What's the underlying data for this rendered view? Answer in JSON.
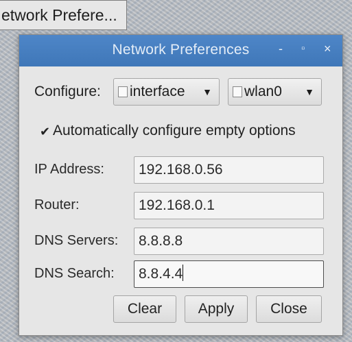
{
  "taskbar": {
    "label": "etwork Prefere..."
  },
  "dialog": {
    "title": "Network Preferences",
    "controls": {
      "minimize": "-",
      "maximize": "▫",
      "close": "×"
    },
    "configure": {
      "label": "Configure:",
      "type_value": "interface",
      "type_icon": "interface-icon",
      "device_value": "wlan0",
      "device_icon": "file-icon"
    },
    "auto_config": {
      "checked": true,
      "label": "Automatically configure empty options"
    },
    "fields": {
      "ip": {
        "label": "IP Address:",
        "value": "192.168.0.56"
      },
      "router": {
        "label": "Router:",
        "value": "192.168.0.1"
      },
      "dns_servers": {
        "label": "DNS Servers:",
        "value": "8.8.8.8"
      },
      "dns_search": {
        "label": "DNS Search:",
        "value": "8.8.4.4"
      }
    },
    "buttons": {
      "clear": "Clear",
      "apply": "Apply",
      "close": "Close"
    }
  },
  "colors": {
    "titlebar": "#4a82c4",
    "dialog_bg": "#e6e6e6"
  }
}
